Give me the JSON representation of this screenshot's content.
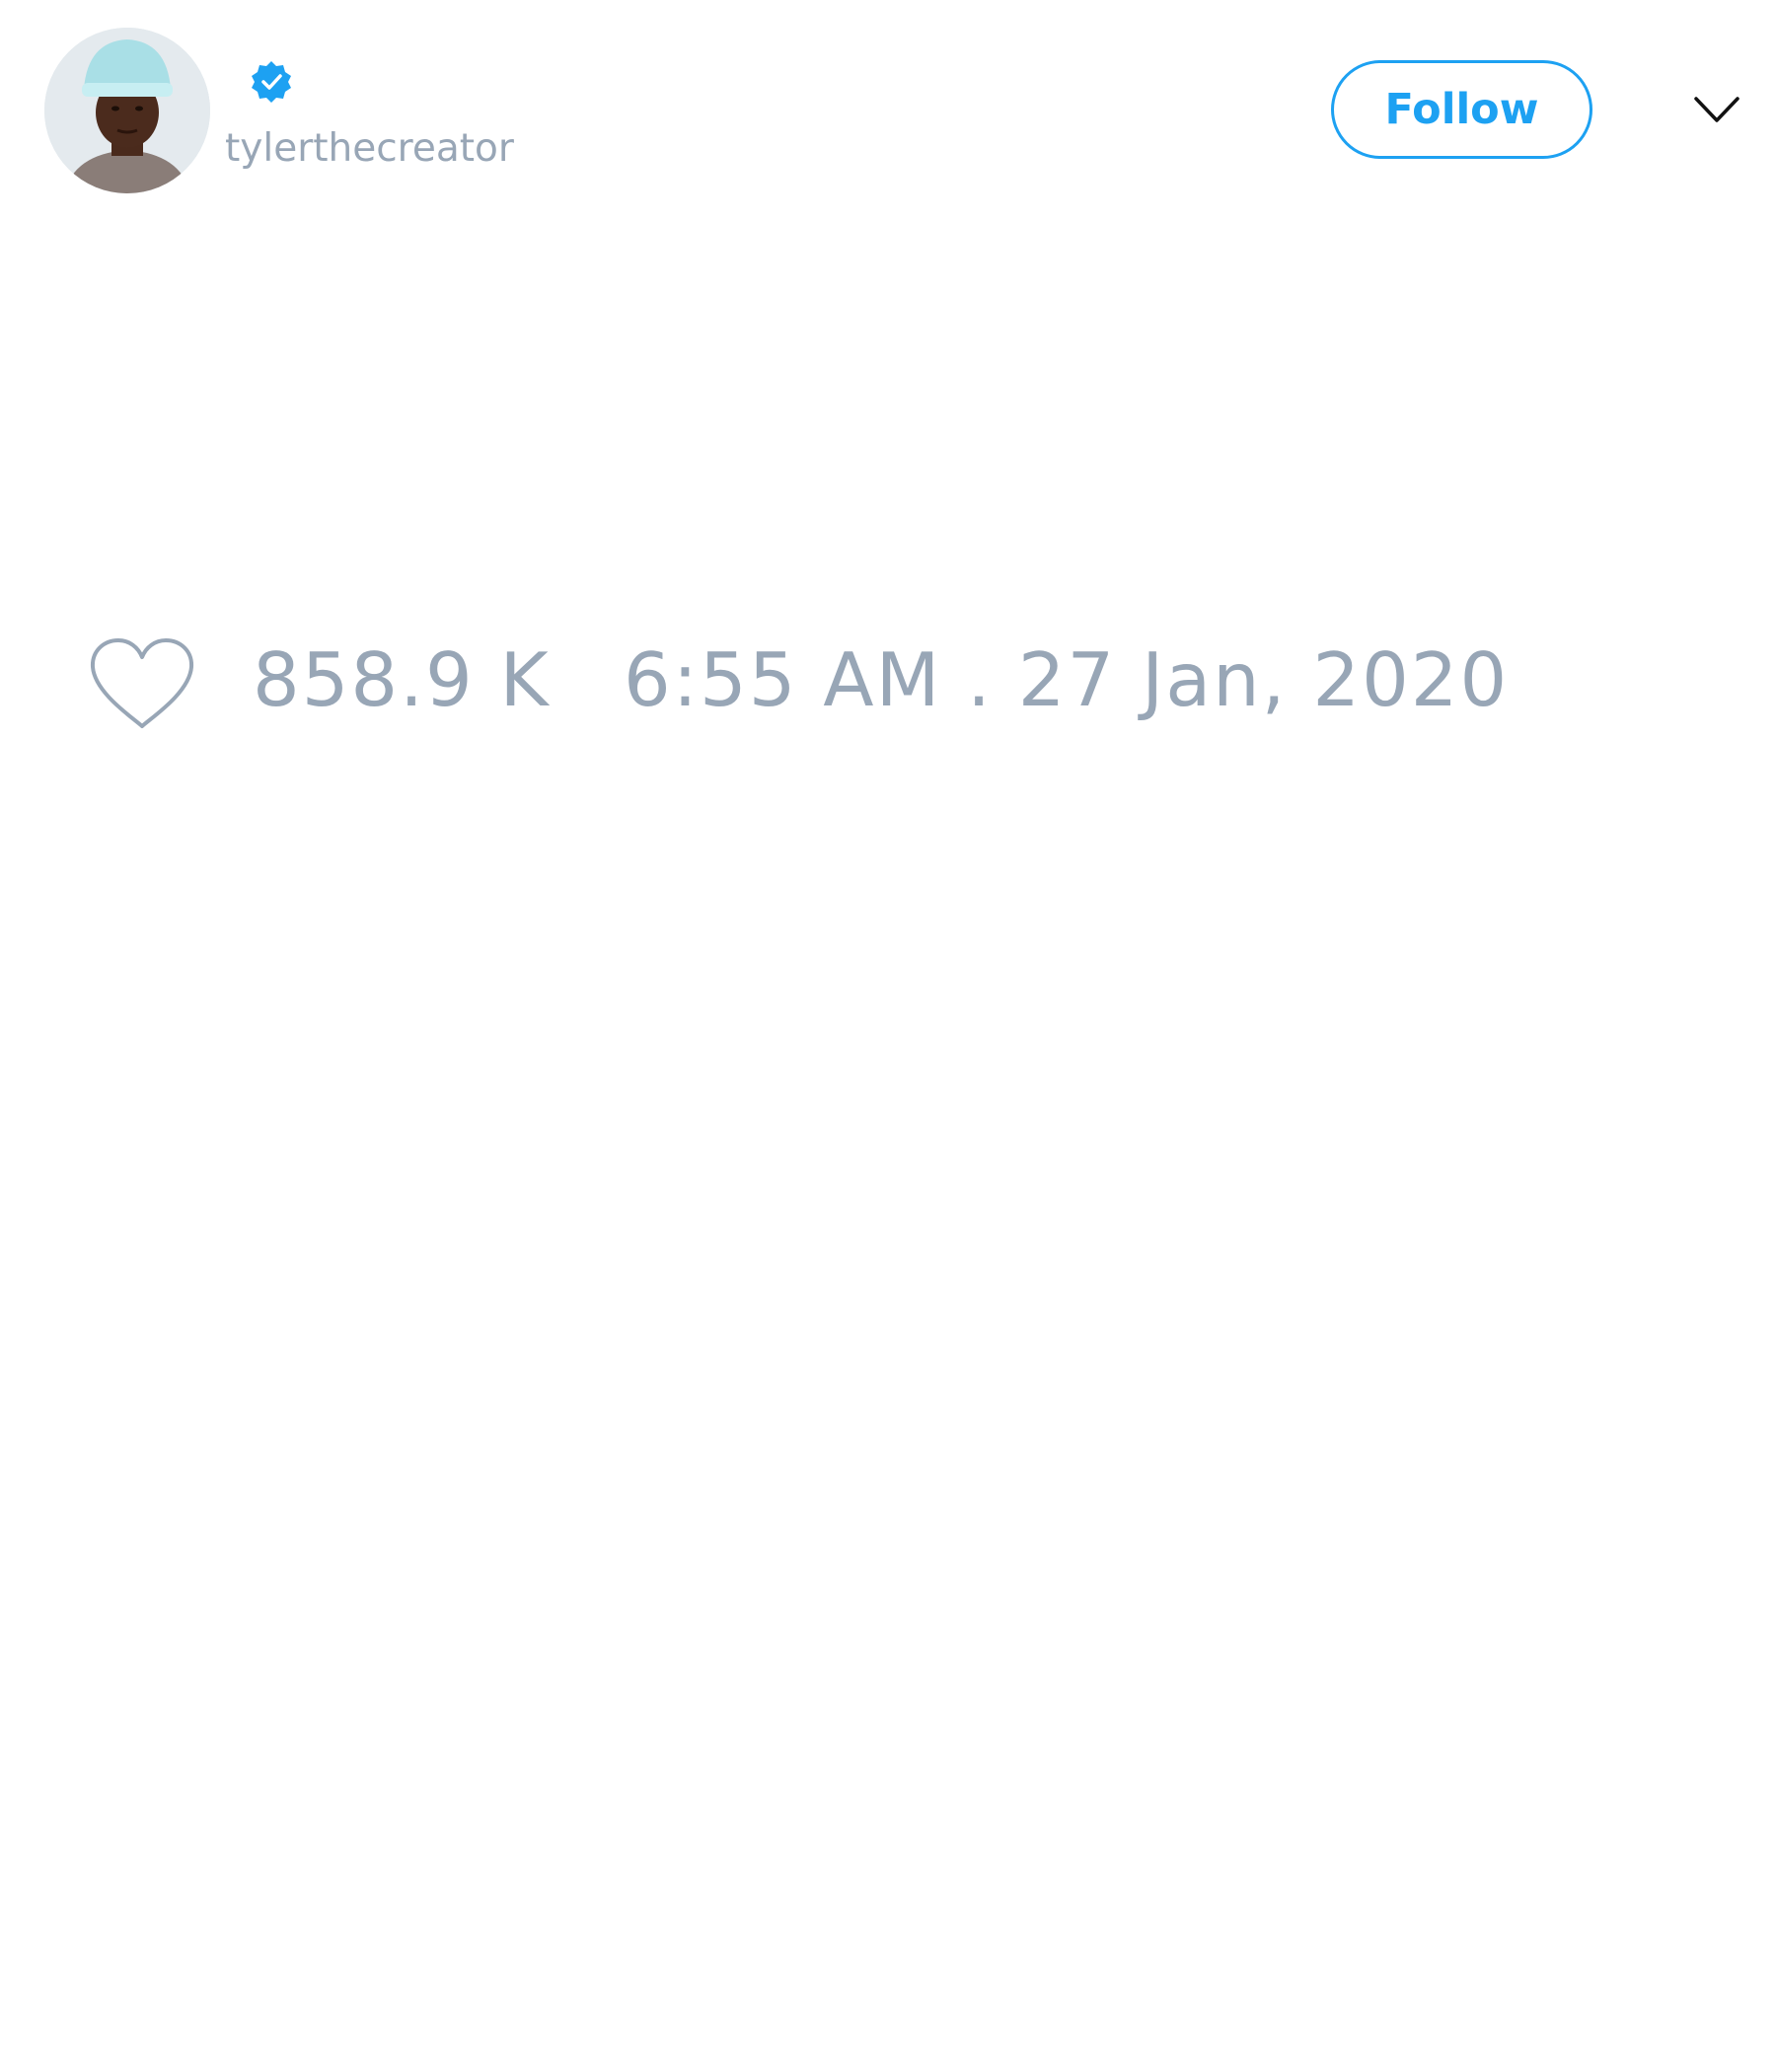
{
  "tweet": {
    "author": {
      "handle": "tylerthecreator",
      "verified": true,
      "avatar_icon": "profile-photo"
    },
    "follow_label": "Follow",
    "menu_icon": "chevron-down-icon",
    "like_icon": "heart-icon",
    "like_count": "858.9 K",
    "timestamp": "6:55 AM . 27 Jan, 2020"
  },
  "colors": {
    "accent": "#1da1f2",
    "muted_text": "#98a6b6",
    "background": "#ffffff"
  }
}
